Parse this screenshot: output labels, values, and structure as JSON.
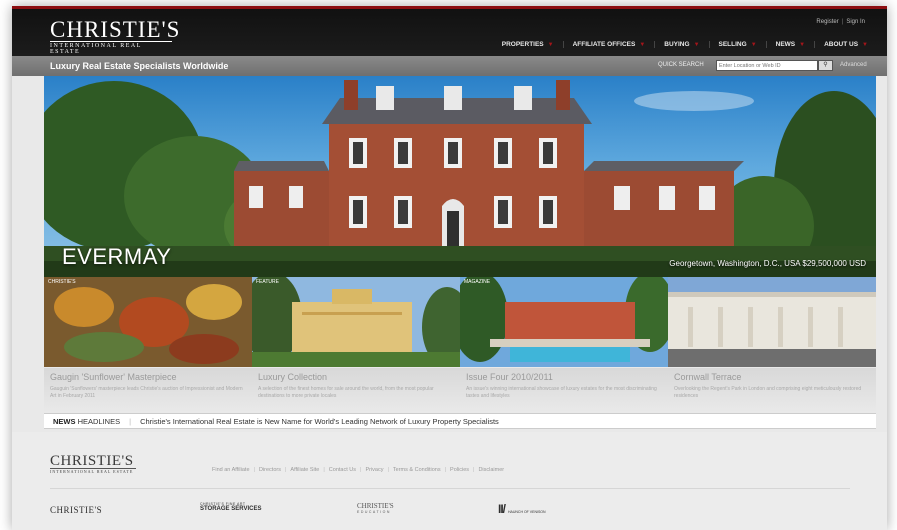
{
  "header": {
    "logo_main": "CHRISTIE'S",
    "logo_sub": "INTERNATIONAL REAL ESTATE",
    "register": "Register",
    "sign_in": "Sign In",
    "nav": [
      {
        "label": "PROPERTIES"
      },
      {
        "label": "AFFILIATE OFFICES"
      },
      {
        "label": "BUYING"
      },
      {
        "label": "SELLING"
      },
      {
        "label": "NEWS"
      },
      {
        "label": "ABOUT US"
      }
    ]
  },
  "subbar": {
    "tagline": "Luxury Real Estate Specialists Worldwide",
    "quick_search_label": "QUICK SEARCH",
    "search_placeholder": "Enter Location or Web ID",
    "search_button_icon": "search-icon",
    "advanced": "Advanced"
  },
  "hero": {
    "title": "EVERMAY",
    "caption": "Georgetown, Washington, D.C., USA $29,500,000 USD"
  },
  "tiles": [
    {
      "tag": "CHRISTIE'S",
      "title": "Gaugin 'Sunflower' Masterpiece",
      "desc": "Gauguin 'Sunflowers' masterpiece leads Christie's auction of Impressionist and Modern Art in February 2011"
    },
    {
      "tag": "FEATURE",
      "title": "Luxury Collection",
      "desc": "A selection of the finest homes for sale around the world, from the most popular destinations to more private locales"
    },
    {
      "tag": "MAGAZINE",
      "title": "Issue Four 2010/2011",
      "desc": "An issue's winning international showcase of luxury estates for the most discriminating tastes and lifestyles"
    },
    {
      "tag": "",
      "title": "Cornwall Terrace",
      "desc": "Overlooking the Regent's Park in London and comprising eight meticulously restored residences"
    }
  ],
  "news": {
    "label_bold": "NEWS",
    "label_rest": " HEADLINES",
    "headline": "Christie's International Real Estate is New Name for World's Leading Network of Luxury Property Specialists"
  },
  "footer": {
    "logo_main": "CHRISTIE'S",
    "logo_sub": "INTERNATIONAL REAL ESTATE",
    "links": [
      "Find an Affiliate",
      "Directors",
      "Affiliate Site",
      "Contact Us",
      "Privacy",
      "Terms & Conditions",
      "Policies",
      "Disclaimer"
    ],
    "brands": {
      "christies": "CHRISTIE'S",
      "storage_small": "CHRISTIE'S FINE ART",
      "storage": "STORAGE SERVICES",
      "education": "CHRISTIE'S",
      "education_small": "EDUCATION",
      "haunch_mark": "II/",
      "haunch_small": "HAUNCH OF VENISON"
    }
  },
  "colors": {
    "accent": "#8c0e12",
    "header_bg": "#151515",
    "subbar_bg": "#7d7d7d"
  }
}
